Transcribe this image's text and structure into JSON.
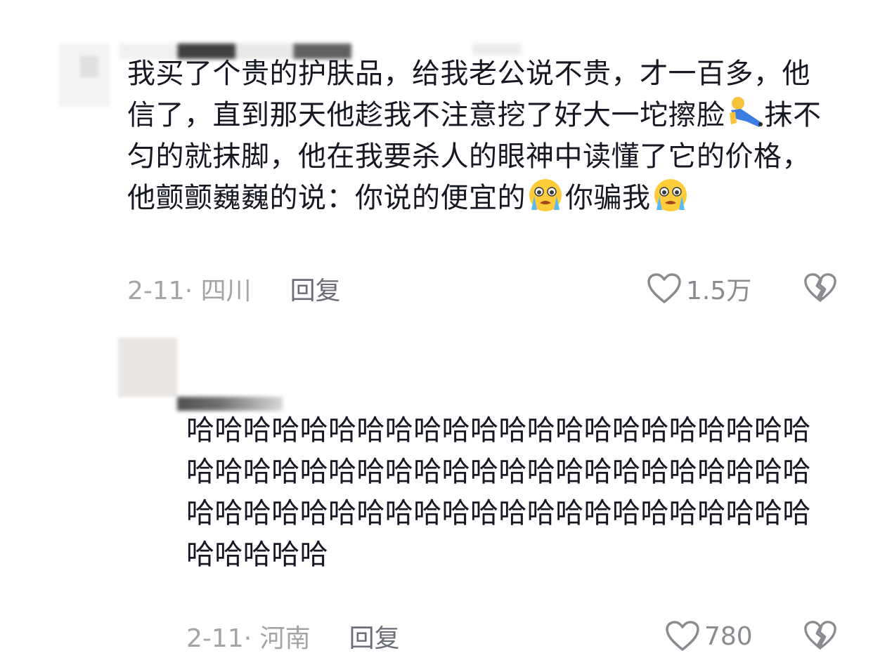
{
  "comments": [
    {
      "text_parts": [
        "我买了个贵的护肤品，给我老公说不贵，才一百多，他信了，直到那天他趁我不注意挖了好大一坨擦脸",
        "抹不匀的就抹脚，他在我要杀人的眼神中读懂了它的价格，他颤颤巍巍的说：你说的便宜的",
        "你骗我"
      ],
      "emojis": [
        "falling-person-emoji",
        "crying-face-emoji",
        "crying-face-emoji"
      ],
      "date_location": "2-11· 四川",
      "reply_label": "回复",
      "like_count": "1.5万"
    },
    {
      "text": "哈哈哈哈哈哈哈哈哈哈哈哈哈哈哈哈哈哈哈哈哈哈哈哈哈哈哈哈哈哈哈哈哈哈哈哈哈哈哈哈哈哈哈哈哈哈哈哈哈哈哈哈哈哈哈哈哈哈哈哈哈哈哈哈哈哈哈哈哈哈哈",
      "date_location": "2-11· 河南",
      "reply_label": "回复",
      "like_count": "780"
    }
  ],
  "icons": {
    "like": "heart-outline-icon",
    "dislike": "broken-heart-icon"
  },
  "colors": {
    "text": "#161823",
    "meta": "#a3a4a8",
    "reply": "#6b6e76",
    "icon": "#8a8b91"
  }
}
